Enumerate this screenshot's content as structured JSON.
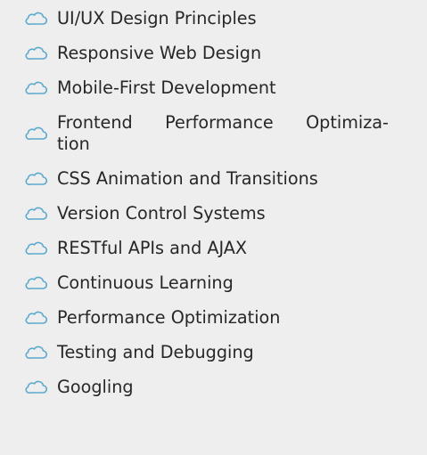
{
  "icon": {
    "name": "cloud-outline-icon",
    "color": "#5ba9cf"
  },
  "skills": [
    {
      "label": "UI/UX Design Principles"
    },
    {
      "label": "Responsive Web Design"
    },
    {
      "label": "Mobile-First Development"
    },
    {
      "label": "Frontend Performance Optimiza-tion",
      "line1": [
        "Frontend",
        "Performance",
        "Optimiza-"
      ],
      "line2": "tion"
    },
    {
      "label": "CSS Animation and Transitions"
    },
    {
      "label": "Version Control Systems"
    },
    {
      "label": "RESTful APIs and AJAX"
    },
    {
      "label": "Continuous Learning"
    },
    {
      "label": "Performance Optimization"
    },
    {
      "label": "Testing and Debugging"
    },
    {
      "label": "Googling"
    }
  ]
}
